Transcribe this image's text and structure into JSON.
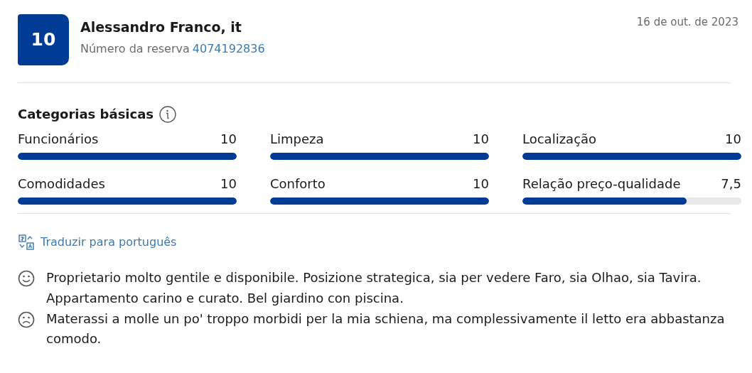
{
  "review": {
    "score": "10",
    "reviewer": "Alessandro Franco, it",
    "booking_label": "Número da reserva",
    "booking_number": "4074192836",
    "date": "16 de out. de 2023"
  },
  "categories": {
    "title": "Categorias básicas",
    "items": [
      {
        "label": "Funcionários",
        "score": "10",
        "level": 1
      },
      {
        "label": "Limpeza",
        "score": "10",
        "level": 1
      },
      {
        "label": "Localização",
        "score": "10",
        "level": 1
      },
      {
        "label": "Comodidades",
        "score": "10",
        "level": 1
      },
      {
        "label": "Conforto",
        "score": "10",
        "level": 1
      },
      {
        "label": "Relação preço-qualidade",
        "score": "7,5",
        "level": 0.75
      }
    ]
  },
  "translate_link": "Traduzir para português",
  "comments": [
    {
      "kind": "positive",
      "text": "Proprietario molto gentile e disponibile. Posizione strategica, sia per vedere Faro, sia Olhao, sia Tavira. Appartamento carino e curato. Bel giardino con piscina."
    },
    {
      "kind": "negative",
      "text": "Materassi a molle un po' troppo morbidi per la mia schiena, ma complessivamente il letto era abbastanza comodo."
    }
  ]
}
